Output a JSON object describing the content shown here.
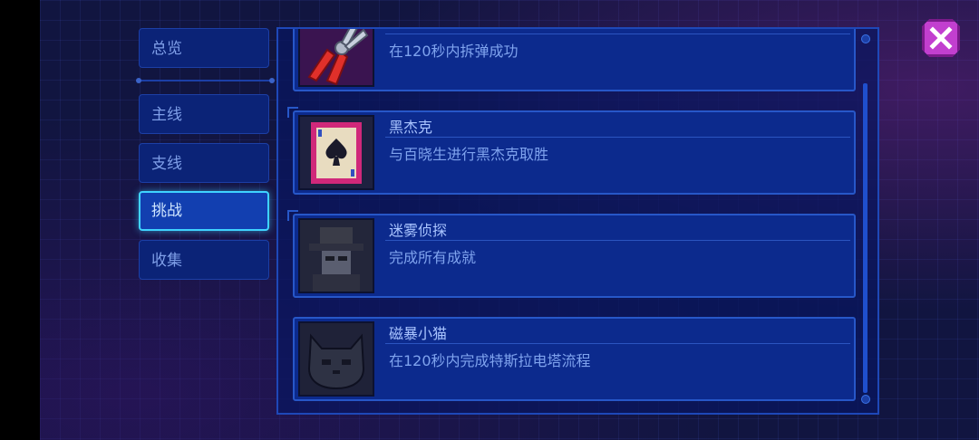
{
  "sidebar": {
    "items": [
      {
        "label": "总览",
        "active": false
      },
      {
        "label": "主线",
        "active": false
      },
      {
        "label": "支线",
        "active": false
      },
      {
        "label": "挑战",
        "active": true
      },
      {
        "label": "收集",
        "active": false
      }
    ]
  },
  "achievements": [
    {
      "title": "",
      "desc": "在120秒内拆弹成功",
      "icon": "pliers-icon"
    },
    {
      "title": "黑杰克",
      "desc": "与百晓生进行黑杰克取胜",
      "icon": "spade-card-icon"
    },
    {
      "title": "迷雾侦探",
      "desc": "完成所有成就",
      "icon": "detective-icon"
    },
    {
      "title": "磁暴小猫",
      "desc": "在120秒内完成特斯拉电塔流程",
      "icon": "cat-icon"
    }
  ],
  "colors": {
    "accent": "#3fd3ff",
    "close_button": "#c23fcf",
    "card_bg": "#0c2a8d"
  }
}
